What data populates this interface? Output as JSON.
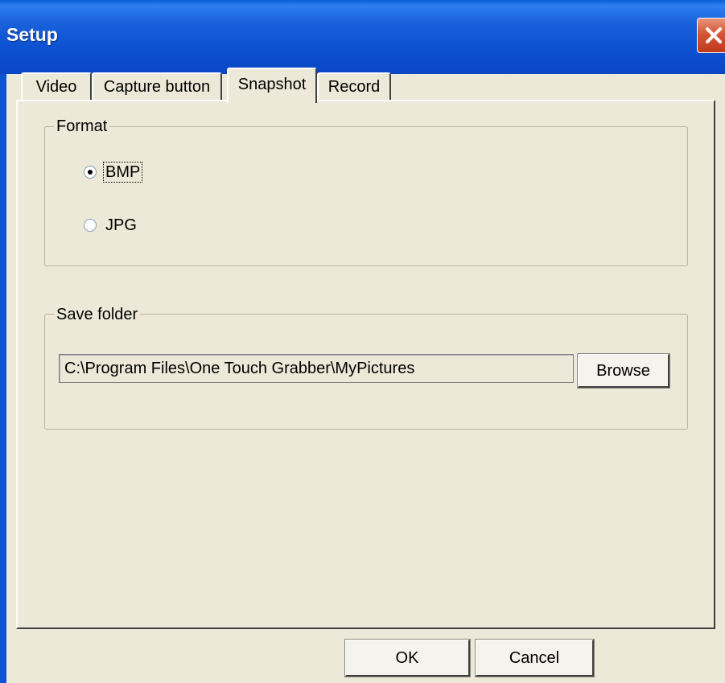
{
  "window": {
    "title": "Setup",
    "close_icon": "close-icon"
  },
  "tabs": [
    {
      "label": "Video",
      "active": false
    },
    {
      "label": "Capture button",
      "active": false
    },
    {
      "label": "Snapshot",
      "active": true
    },
    {
      "label": "Record",
      "active": false
    }
  ],
  "format": {
    "group_label": "Format",
    "options": [
      {
        "label": "BMP",
        "checked": true
      },
      {
        "label": "JPG",
        "checked": false
      }
    ]
  },
  "save_folder": {
    "group_label": "Save folder",
    "path": "C:\\Program Files\\One Touch Grabber\\MyPictures",
    "browse_label": "Browse"
  },
  "footer": {
    "ok_label": "OK",
    "cancel_label": "Cancel"
  },
  "colors": {
    "titlebar": "#0b4fd0",
    "dialog_bg": "#ece9d8",
    "close_button": "#d55637"
  }
}
